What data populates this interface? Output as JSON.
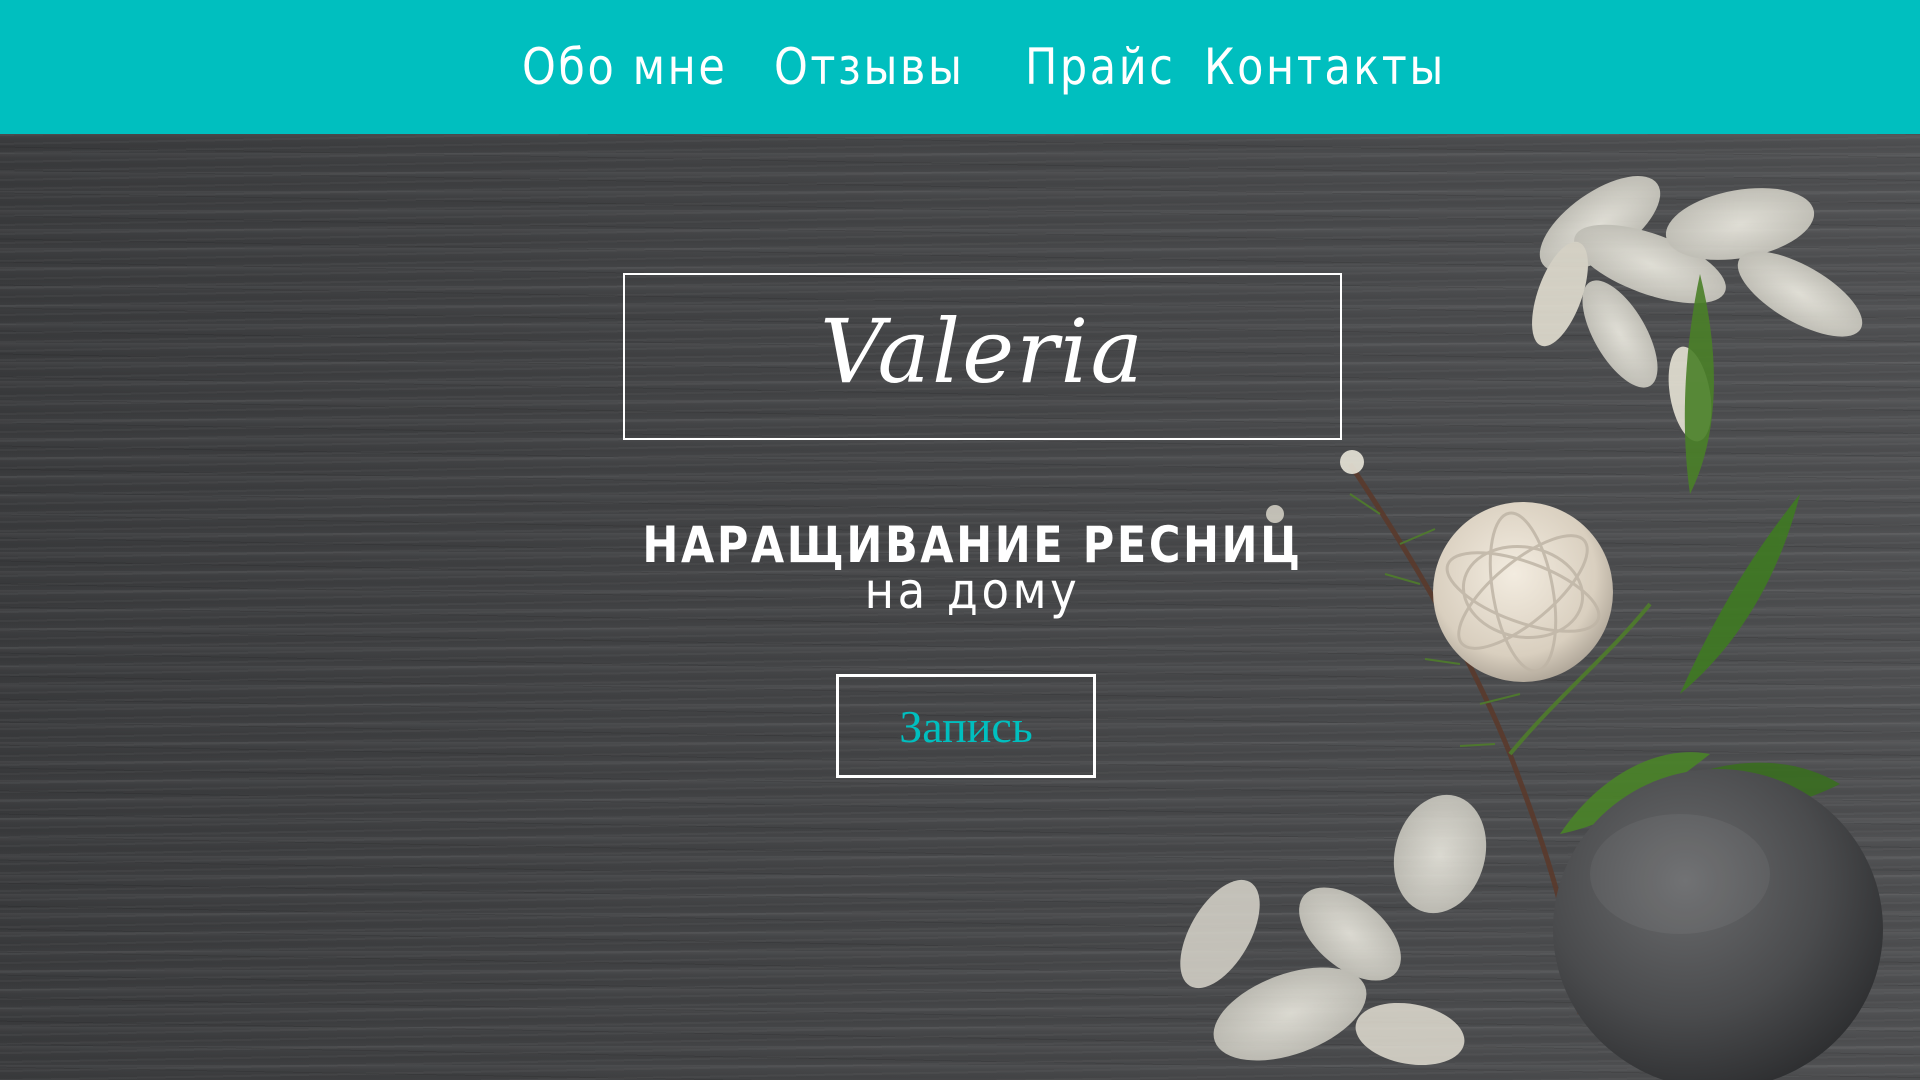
{
  "nav": {
    "items": [
      {
        "label": "Обо мне"
      },
      {
        "label": "Отзывы"
      },
      {
        "label": "Прайс"
      },
      {
        "label": "Контакты"
      }
    ]
  },
  "hero": {
    "logo_text": "Valeria",
    "headline": "НАРАЩИВАНИЕ РЕСНИЦ",
    "subheadline": "на дому",
    "cta_label": "Запись"
  },
  "colors": {
    "accent": "#00bfbf",
    "text": "#ffffff",
    "background": "#3f4042"
  }
}
